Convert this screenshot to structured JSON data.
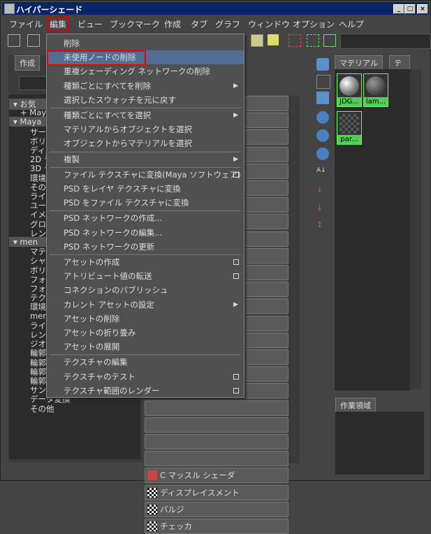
{
  "window": {
    "title": "ハイパーシェード"
  },
  "menubar": [
    "ファイル",
    "編集",
    "ビュー",
    "ブックマーク",
    "作成",
    "タブ",
    "グラフ",
    "ウィンドウ",
    "オプション",
    "ヘルプ"
  ],
  "left_tab": "作成",
  "tree": [
    "お気",
    "Maya",
    "Maya",
    "サー",
    "ボリ",
    "ディ",
    "2D テ",
    "3D テ",
    "環境",
    "その",
    "ライ",
    "ユー",
    "イメ",
    "グロ",
    "レン",
    "men",
    "マテ",
    "シャ",
    "ボリ",
    "フォ",
    "フォ",
    "テク",
    "環境",
    "men",
    "ライ",
    "レン",
    "ジオ",
    "輪郭",
    "輪郭",
    "輪郭",
    "輪郭",
    "サンプル合成",
    "データ変換",
    "その他"
  ],
  "create_buttons": [
    "C マッスル シェーダ",
    "ディスプレイスメント",
    "バルジ",
    "チェッカ"
  ],
  "right_tabs": [
    "マテリアル",
    "テ"
  ],
  "swatches": [
    "JDG...",
    "lam...",
    "par..."
  ],
  "work_area": {
    "title": "作業領域"
  },
  "context_menu": {
    "items": [
      {
        "label": "削除"
      },
      {
        "label": "未使用ノードの削除",
        "highlighted": true
      },
      {
        "label": "重複シェーディング ネットワークの削除"
      },
      {
        "label": "種類ごとにすべてを削除",
        "submenu": true
      },
      {
        "label": "選択したスウォッチを元に戻す"
      },
      {
        "label": "種類ごとにすべてを選択",
        "submenu": true
      },
      {
        "label": "マテリアルからオブジェクトを選択"
      },
      {
        "label": "オブジェクトからマテリアルを選択"
      },
      {
        "label": "複製",
        "submenu": true
      },
      {
        "label": "ファイル テクスチャに変換(Maya ソフトウェア)",
        "option": true
      },
      {
        "label": "PSD をレイヤ テクスチャに変換"
      },
      {
        "label": "PSD をファイル テクスチャに変換"
      },
      {
        "label": "PSD ネットワークの作成..."
      },
      {
        "label": "PSD ネットワークの編集..."
      },
      {
        "label": "PSD ネットワークの更新"
      },
      {
        "label": "アセットの作成",
        "option": true
      },
      {
        "label": "アトリビュート値の転送",
        "option": true
      },
      {
        "label": "コネクションのパブリッシュ"
      },
      {
        "label": "カレント アセットの設定",
        "submenu": true
      },
      {
        "label": "アセットの削除"
      },
      {
        "label": "アセットの折り畳み"
      },
      {
        "label": "アセットの展開"
      },
      {
        "label": "テクスチャの編集"
      },
      {
        "label": "テクスチャのテスト",
        "option": true
      },
      {
        "label": "テクスチャ範囲のレンダー",
        "option": true
      }
    ]
  },
  "colors": {
    "accent": "#0a246a",
    "highlight": "#506e94",
    "swatch_label": "#55cc55",
    "annotation_red": "#e00000"
  }
}
